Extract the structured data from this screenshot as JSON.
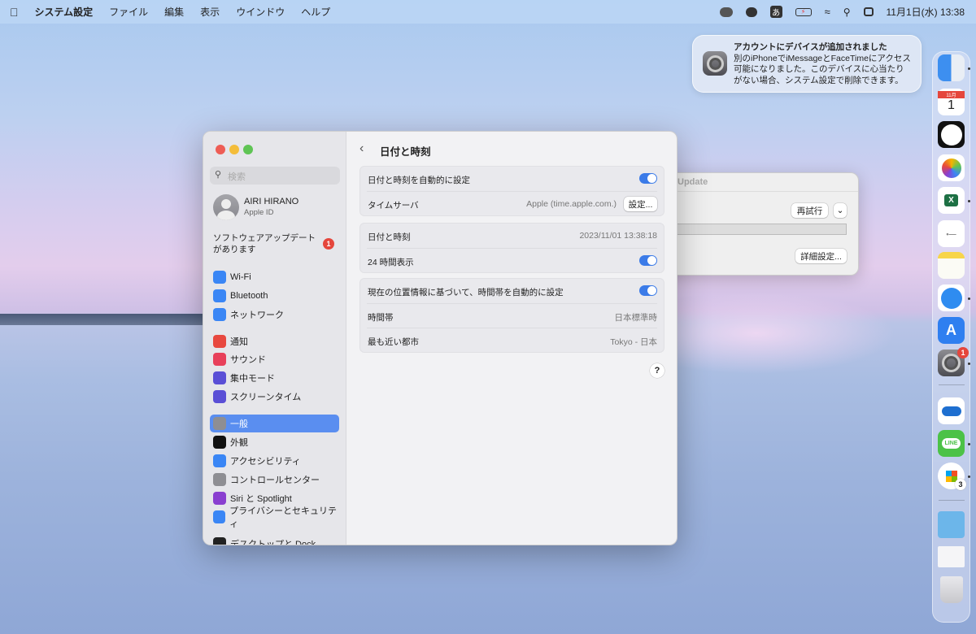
{
  "menubar": {
    "app": "システム設定",
    "items": [
      "ファイル",
      "編集",
      "表示",
      "ウインドウ",
      "ヘルプ"
    ],
    "ime": "あ",
    "clock": "11月1日(水)  13:38"
  },
  "notification": {
    "title": "アカウントにデバイスが追加されました",
    "body": "別のiPhoneでiMessageとFaceTimeにアクセス可能になりました。このデバイスに心当たりがない場合、システム設定で削除できます。"
  },
  "background_window": {
    "title": "Update",
    "retry": "再試行",
    "advanced": "詳細設定..."
  },
  "sidebar": {
    "search_placeholder": "検索",
    "user": {
      "name": "AIRI HIRANO",
      "sub": "Apple ID"
    },
    "update": {
      "text": "ソフトウェアアップデートがあります",
      "badge": "1"
    },
    "items": [
      {
        "label": "Wi-Fi",
        "color": "#3a86f5",
        "icon": "wifi-icon"
      },
      {
        "label": "Bluetooth",
        "color": "#3a86f5",
        "icon": "bluetooth-icon"
      },
      {
        "label": "ネットワーク",
        "color": "#3a86f5",
        "icon": "globe-icon"
      },
      {
        "label": "通知",
        "color": "#e8483f",
        "icon": "bell-icon"
      },
      {
        "label": "サウンド",
        "color": "#e8405a",
        "icon": "speaker-icon"
      },
      {
        "label": "集中モード",
        "color": "#5a4fd6",
        "icon": "moon-icon"
      },
      {
        "label": "スクリーンタイム",
        "color": "#5a4fd6",
        "icon": "hourglass-icon"
      },
      {
        "label": "一般",
        "color": "#8e8e93",
        "icon": "gear-icon",
        "selected": true
      },
      {
        "label": "外観",
        "color": "#111111",
        "icon": "appearance-icon"
      },
      {
        "label": "アクセシビリティ",
        "color": "#3a86f5",
        "icon": "accessibility-icon"
      },
      {
        "label": "コントロールセンター",
        "color": "#8e8e93",
        "icon": "control-center-icon"
      },
      {
        "label": "Siri と Spotlight",
        "color": "#8a3fd0",
        "icon": "siri-icon"
      },
      {
        "label": "プライバシーとセキュリティ",
        "color": "#3a86f5",
        "icon": "hand-icon"
      },
      {
        "label": "デスクトップと Dock",
        "color": "#222222",
        "icon": "dock-icon"
      }
    ]
  },
  "main": {
    "title": "日付と時刻",
    "auto_set": {
      "label": "日付と時刻を自動的に設定",
      "on": true
    },
    "time_server": {
      "label": "タイムサーバ",
      "value": "Apple (time.apple.com.)",
      "button": "設定..."
    },
    "datetime": {
      "label": "日付と時刻",
      "value": "2023/11/01 13:38:18"
    },
    "h24": {
      "label": "24 時間表示",
      "on": true
    },
    "auto_tz": {
      "label": "現在の位置情報に基づいて、時間帯を自動的に設定",
      "on": true
    },
    "timezone": {
      "label": "時間帯",
      "value": "日本標準時"
    },
    "city": {
      "label": "最も近い都市",
      "value": "Tokyo - 日本"
    },
    "help": "?"
  },
  "dock": {
    "calendar_month": "11月",
    "calendar_day": "1",
    "settings_badge": "1",
    "installer_badge": "3",
    "line_label": "LINE",
    "excel_label": "X"
  }
}
